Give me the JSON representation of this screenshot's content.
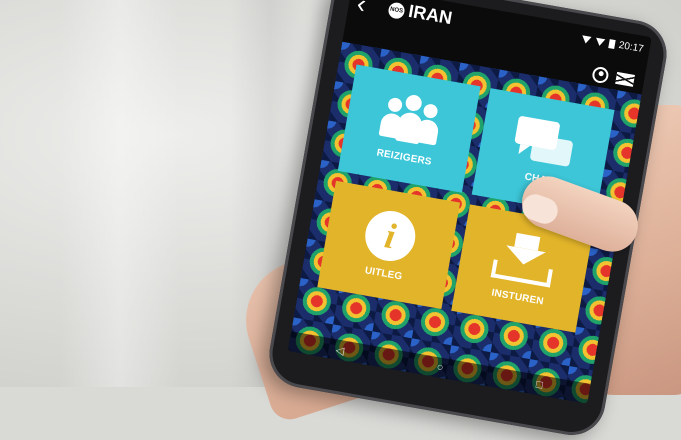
{
  "app": {
    "title": "IRAN",
    "logo_text": "NOS",
    "status_time": "20:17"
  },
  "header_icons": [
    "user-icon",
    "mail-icon"
  ],
  "tiles": [
    {
      "label": "REIZIGERS",
      "icon": "people-icon",
      "color": "#3cc6d8"
    },
    {
      "label": "CHAT",
      "icon": "chat-icon",
      "color": "#3cc6d8"
    },
    {
      "label": "UITLEG",
      "icon": "info-icon",
      "color": "#e2b42a"
    },
    {
      "label": "INSTUREN",
      "icon": "download-icon",
      "color": "#e2b42a"
    }
  ],
  "nav": {
    "back": "◁",
    "home": "○",
    "recent": "□"
  }
}
